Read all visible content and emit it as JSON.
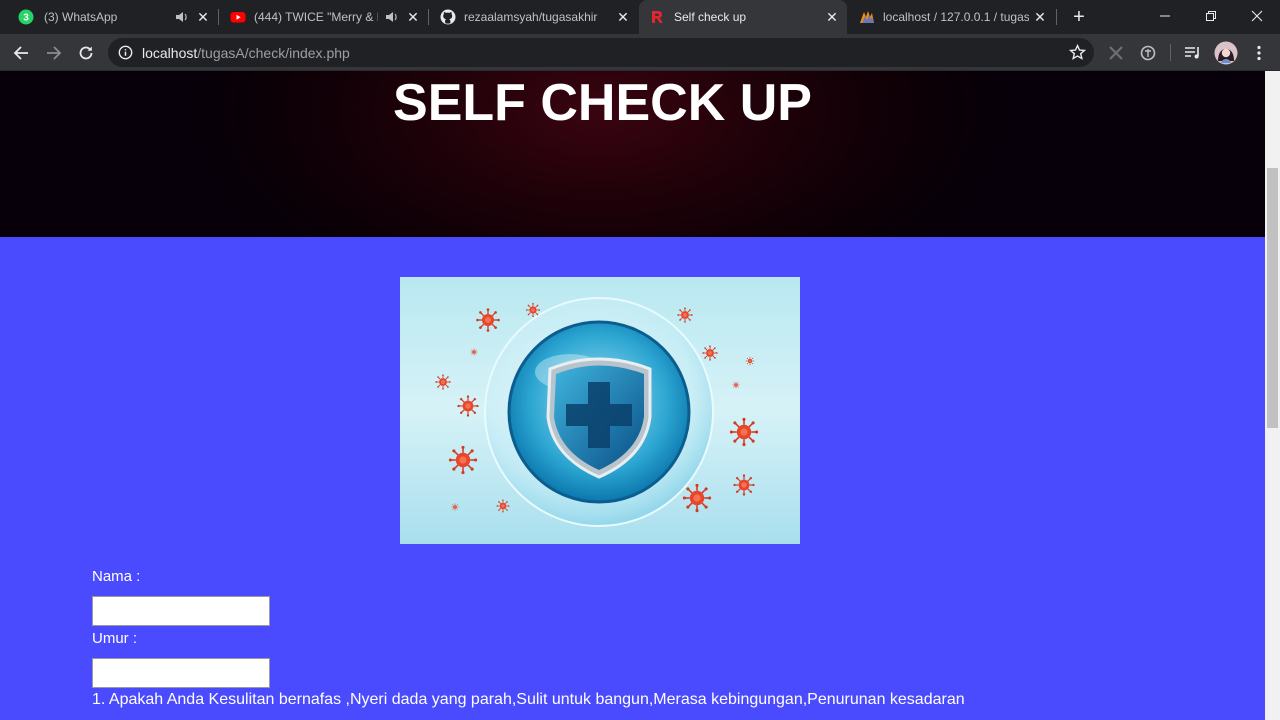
{
  "browser": {
    "tabs": [
      {
        "title": "(3) WhatsApp",
        "icon": "whatsapp-icon",
        "audio": true,
        "active": false
      },
      {
        "title": "(444) TWICE \"Merry & H",
        "icon": "youtube-icon",
        "audio": true,
        "active": false
      },
      {
        "title": "rezaalamsyah/tugasakhir",
        "icon": "github-icon",
        "audio": false,
        "active": false
      },
      {
        "title": "Self check up",
        "icon": "r-logo-icon",
        "audio": false,
        "active": true
      },
      {
        "title": "localhost / 127.0.0.1 / tugas",
        "icon": "phpmyadmin-icon",
        "audio": false,
        "active": false
      }
    ],
    "whatsapp_badge": "3",
    "address": {
      "host": "localhost",
      "path": "/tugasA/check/index.php"
    }
  },
  "page": {
    "title": "SELF CHECK UP",
    "illustration": "virus-protection-shield-illustration",
    "form": {
      "name_label": "Nama :",
      "name_value": "",
      "age_label": "Umur :",
      "age_value": "",
      "question_1": "1. Apakah Anda Kesulitan bernafas ,Nyeri dada yang parah,Sulit untuk bangun,Merasa kebingungan,Penurunan kesadaran"
    }
  },
  "colors": {
    "page_background": "#4a4aff",
    "hero_background": "#0a0006",
    "browser_frame": "#202124",
    "toolbar": "#35363a"
  }
}
